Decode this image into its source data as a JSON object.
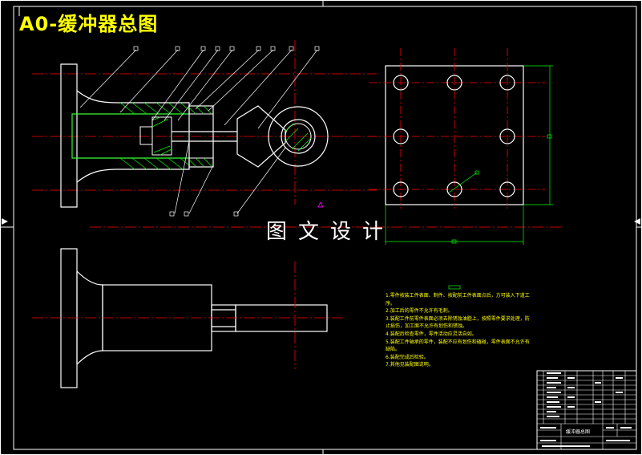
{
  "drawing_title": "A0-缓冲器总图",
  "watermark": "图文设计",
  "notes": [
    "1.零件按装工件表面、制件、按配前工件表面点后，方可装入下道工序。",
    "2.加工后的零件不允许有毛刺。",
    "3.装配工件前零件表面必须去除锈蚀油脂上，按照零件要求处理，防止损伤，加工面不允许有划伤和锈蚀。",
    "4.装配后检查零件，零件活动应灵活自如。",
    "5.装配工件轴承的零件，装配不应有划伤和磕碰，零件表面不允许有缺陷。",
    "6.装配完成后检验。",
    "7.其他见装配图说明。"
  ],
  "title_block_name": "缓冲器总图",
  "colors": {
    "background": "#000000",
    "outline": "#ffffff",
    "centerline": "#ff0000",
    "dimension": "#00ff00",
    "section": "#00ff00",
    "text": "#ffff00"
  }
}
